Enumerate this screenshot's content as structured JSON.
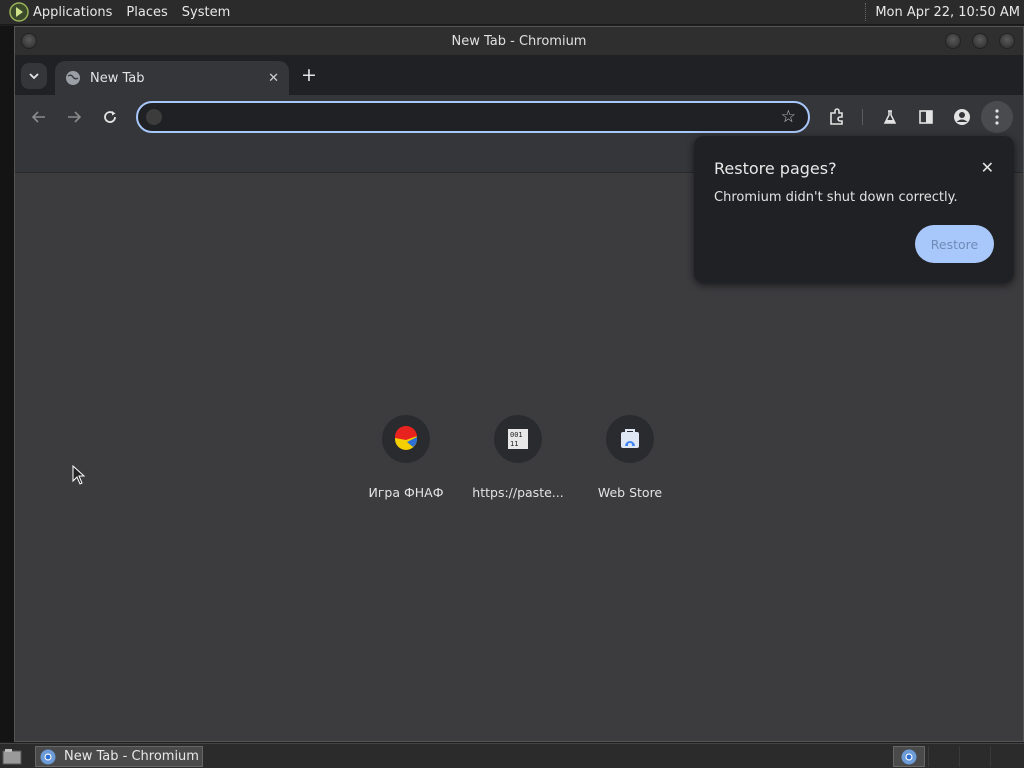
{
  "top_panel": {
    "menus": [
      "Applications",
      "Places",
      "System"
    ],
    "clock": "Mon Apr 22, 10:50 AM"
  },
  "window": {
    "title": "New Tab - Chromium"
  },
  "tabs": {
    "active_label": "New Tab",
    "close_glyph": "✕",
    "new_tab_glyph": "+"
  },
  "omnibox": {
    "value": "",
    "placeholder": ""
  },
  "shortcuts": [
    {
      "label": "Игра ФНАФ",
      "icon": "game-icon"
    },
    {
      "label": "https://paste...",
      "icon": "binary-file-icon"
    },
    {
      "label": "Web Store",
      "icon": "web-store-icon"
    }
  ],
  "restore_bubble": {
    "title": "Restore pages?",
    "message": "Chromium didn't shut down correctly.",
    "button": "Restore",
    "close_glyph": "✕"
  },
  "taskbar": {
    "window_label": "New Tab - Chromium"
  },
  "colors": {
    "accent": "#a8c7fa",
    "toolbar": "#35363a",
    "tabstrip": "#202124",
    "content": "#3c3c3f"
  }
}
